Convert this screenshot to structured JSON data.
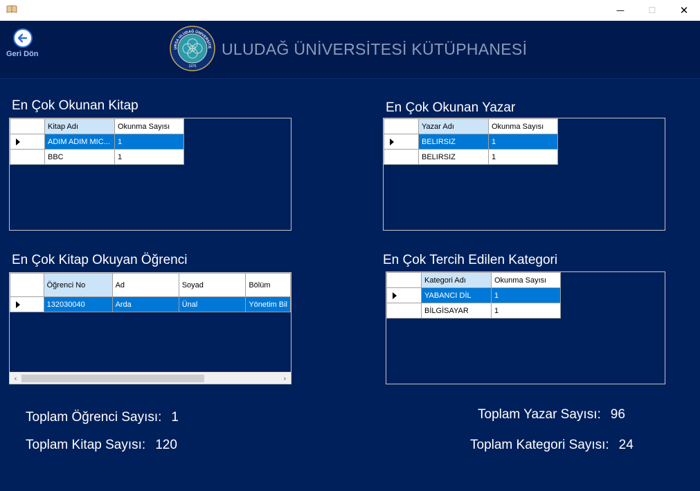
{
  "window": {
    "minimize_glyph": "—",
    "maximize_glyph": "☐",
    "close_glyph": "✕"
  },
  "header": {
    "back_label": "Geri Dön",
    "title": "ULUDAĞ ÜNİVERSİTESİ KÜTÜPHANESİ",
    "logo_text": "BURSA ULUDAĞ ÜNİVERSİTESİ",
    "logo_year": "1975"
  },
  "sections": {
    "top_book": {
      "title": "En Çok Okunan Kitap",
      "columns": [
        "Kitap Adı",
        "Okunma Sayısı"
      ],
      "rows": [
        [
          "ADIM ADIM MIC...",
          "1"
        ],
        [
          "BBC",
          "1"
        ]
      ]
    },
    "top_author": {
      "title": "En Çok Okunan Yazar",
      "columns": [
        "Yazar Adı",
        "Okunma Sayısı"
      ],
      "rows": [
        [
          "BELIRSIZ",
          "1"
        ],
        [
          "BELIRSIZ",
          "1"
        ]
      ]
    },
    "top_student": {
      "title": "En Çok Kitap Okuyan Öğrenci",
      "columns": [
        "Öğrenci No",
        "Ad",
        "Soyad",
        "Bölüm"
      ],
      "rows": [
        [
          "132030040",
          "Arda",
          "Ünal",
          "Yönetim Bil"
        ]
      ]
    },
    "top_category": {
      "title": "En Çok Tercih Edilen Kategori",
      "columns": [
        "Kategori Adı",
        "Okunma Sayısı"
      ],
      "rows": [
        [
          "YABANCI DİL",
          "1"
        ],
        [
          "BİLGİSAYAR",
          "1"
        ]
      ]
    }
  },
  "totals": {
    "students_label": "Toplam Öğrenci Sayısı:",
    "students_value": "1",
    "books_label": "Toplam Kitap Sayısı:",
    "books_value": "120",
    "authors_label": "Toplam Yazar Sayısı:",
    "authors_value": "96",
    "categories_label": "Toplam Kategori Sayısı:",
    "categories_value": "24"
  },
  "colors": {
    "background": "#00205b",
    "selection": "#0078d7",
    "header_selected": "#cce4f7"
  },
  "scrollbar": {
    "left_glyph": "‹",
    "right_glyph": "›"
  }
}
